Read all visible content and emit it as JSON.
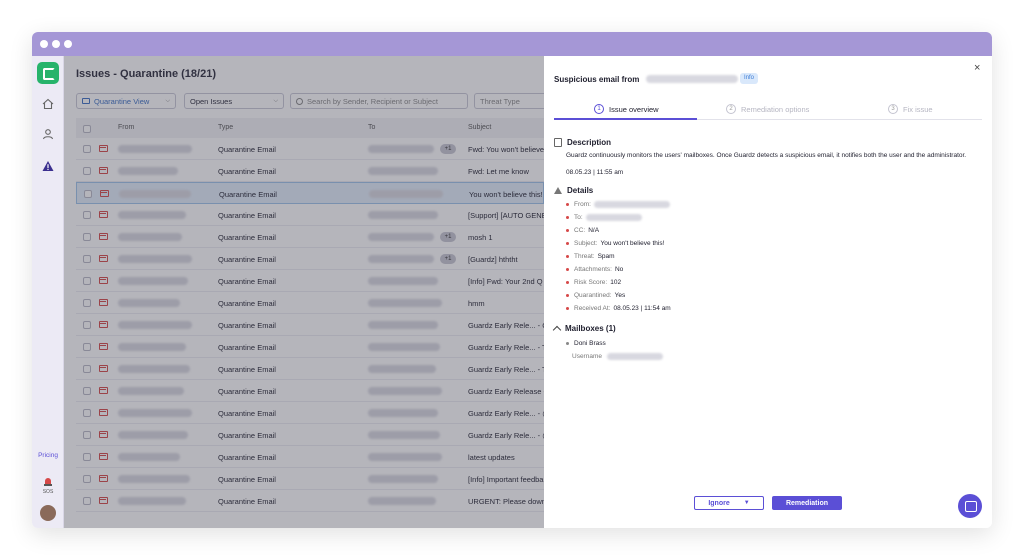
{
  "colors": {
    "titlebar": "#a597d6",
    "accent": "#5b4fd6",
    "brand": "#27b36b",
    "danger": "#d64848",
    "selected_row": "#e3eefb"
  },
  "sidebar": {
    "icons": [
      "home-icon",
      "user-icon",
      "warning-icon"
    ],
    "pricing_label": "Pricing",
    "sos_label": "SOS"
  },
  "main": {
    "title": "Issues - Quarantine (18/21)",
    "toolbar": {
      "view_select": "Quarantine View",
      "status_select": "Open Issues",
      "search_placeholder": "Search by Sender, Recipient or Subject",
      "threat_select": "Threat Type"
    },
    "columns": {
      "from": "From",
      "type": "Type",
      "to": "To",
      "subject": "Subject"
    },
    "rows": [
      {
        "type": "Quarantine Email",
        "plus": "+1",
        "subject": "Fwd: You won't believe"
      },
      {
        "type": "Quarantine Email",
        "plus": "",
        "subject": "Fwd: Let me know"
      },
      {
        "type": "Quarantine Email",
        "plus": "",
        "subject": "You won't believe this!"
      },
      {
        "type": "Quarantine Email",
        "plus": "",
        "subject": "[Support] [AUTO GENE"
      },
      {
        "type": "Quarantine Email",
        "plus": "+1",
        "subject": "mosh 1"
      },
      {
        "type": "Quarantine Email",
        "plus": "+1",
        "subject": "[Guardz] hththt"
      },
      {
        "type": "Quarantine Email",
        "plus": "",
        "subject": "[Info] Fwd: Your 2nd Q"
      },
      {
        "type": "Quarantine Email",
        "plus": "",
        "subject": "hmm"
      },
      {
        "type": "Quarantine Email",
        "plus": "",
        "subject": "Guardz Early Rele... - C"
      },
      {
        "type": "Quarantine Email",
        "plus": "",
        "subject": "Guardz Early Rele... - T"
      },
      {
        "type": "Quarantine Email",
        "plus": "",
        "subject": "Guardz Early Rele... - T"
      },
      {
        "type": "Quarantine Email",
        "plus": "",
        "subject": "Guardz Early Release -"
      },
      {
        "type": "Quarantine Email",
        "plus": "",
        "subject": "Guardz Early Rele... - @"
      },
      {
        "type": "Quarantine Email",
        "plus": "",
        "subject": "Guardz Early Rele... - @"
      },
      {
        "type": "Quarantine Email",
        "plus": "",
        "subject": "latest updates"
      },
      {
        "type": "Quarantine Email",
        "plus": "",
        "subject": "[Info] Important feedba"
      },
      {
        "type": "Quarantine Email",
        "plus": "",
        "subject": "URGENT: Please downl"
      }
    ]
  },
  "panel": {
    "title": "Suspicious email from",
    "badge": "Info",
    "close": "×",
    "steps": [
      {
        "num": "1",
        "label": "Issue overview"
      },
      {
        "num": "2",
        "label": "Remediation options"
      },
      {
        "num": "3",
        "label": "Fix issue"
      }
    ],
    "description": {
      "heading": "Description",
      "text": "Guardz continuously monitors the users' mailboxes. Once Guardz detects a suspicious email, it notifies both the user and the administrator.",
      "date": "08.05.23 | 11:55 am"
    },
    "details": {
      "heading": "Details",
      "items": [
        {
          "key": "From:",
          "value": ""
        },
        {
          "key": "To:",
          "value": ""
        },
        {
          "key": "CC:",
          "value": "N/A"
        },
        {
          "key": "Subject:",
          "value": "You won't believe this!"
        },
        {
          "key": "Threat:",
          "value": "Spam"
        },
        {
          "key": "Attachments:",
          "value": "No"
        },
        {
          "key": "Risk Score:",
          "value": "102"
        },
        {
          "key": "Quarantined:",
          "value": "Yes"
        },
        {
          "key": "Received At:",
          "value": "08.05.23 | 11:54 am"
        }
      ]
    },
    "mailboxes": {
      "heading": "Mailboxes (1)",
      "name": "Doni Brass",
      "username_label": "Username"
    },
    "buttons": {
      "ignore": "Ignore",
      "remediation": "Remediation"
    }
  }
}
